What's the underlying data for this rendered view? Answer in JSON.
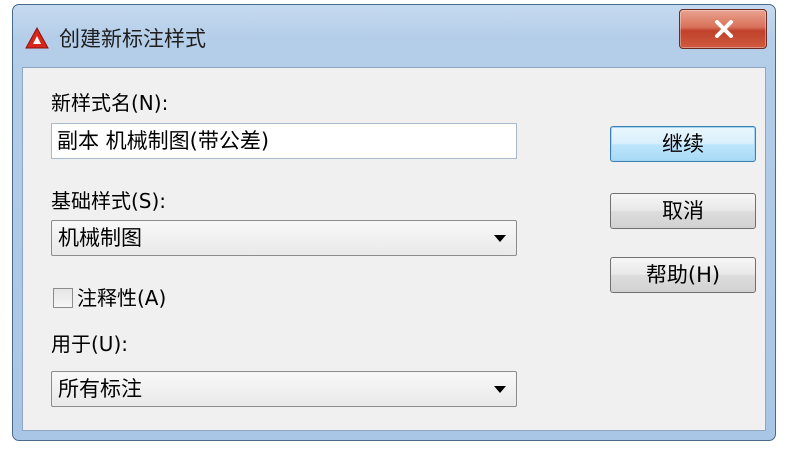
{
  "window": {
    "title": "创建新标注样式",
    "app_icon": "autocad-icon",
    "close_label": "X"
  },
  "form": {
    "new_style_name_label": "新样式名(N):",
    "new_style_name_value": "副本 机械制图(带公差)",
    "base_style_label": "基础样式(S):",
    "base_style_value": "机械制图",
    "annotative_label": "注释性(A)",
    "annotative_checked": false,
    "use_for_label": "用于(U):",
    "use_for_value": "所有标注"
  },
  "buttons": {
    "continue": "继续",
    "cancel": "取消",
    "help": "帮助(H)"
  },
  "colors": {
    "accent": "#d9261c",
    "title_bar": "#b4cde8",
    "close_button": "#c0412b",
    "default_button": "#bee6fd"
  }
}
